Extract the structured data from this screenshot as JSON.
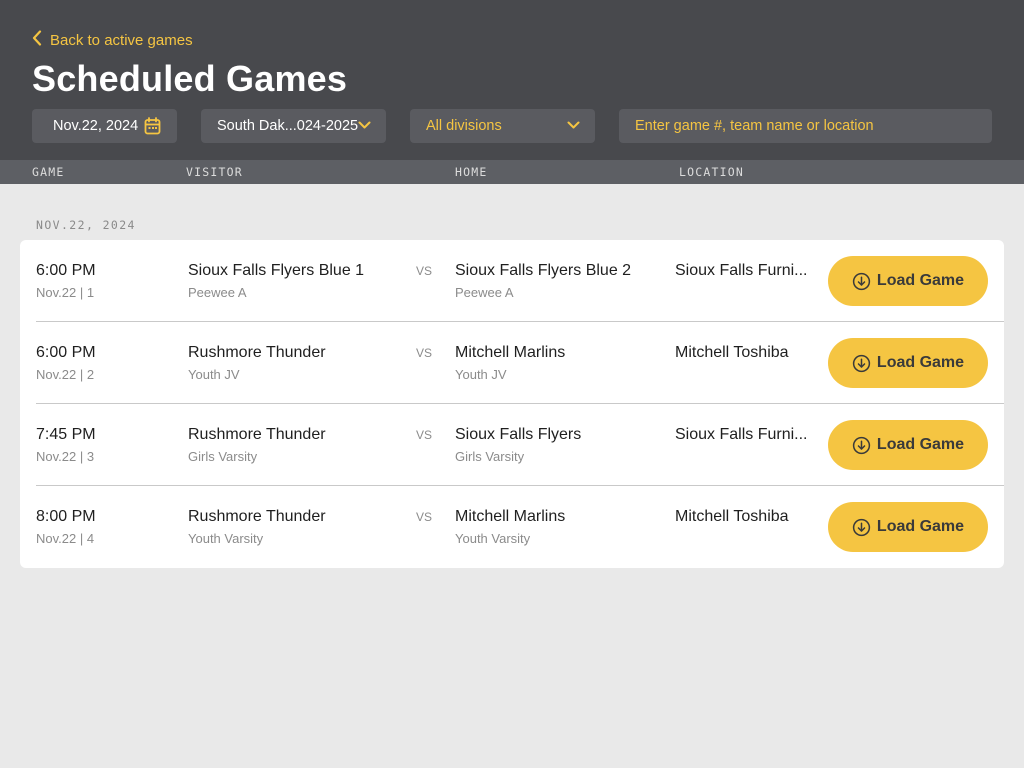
{
  "nav": {
    "back_label": "Back to active games"
  },
  "page": {
    "title": "Scheduled Games"
  },
  "filters": {
    "date": "Nov.22, 2024",
    "league": "South Dak...024-2025",
    "division": "All divisions",
    "search_placeholder": "Enter game #, team name or location"
  },
  "columns": {
    "game": "GAME",
    "visitor": "VISITOR",
    "home": "HOME",
    "location": "LOCATION"
  },
  "date_heading": "NOV.22, 2024",
  "vs_label": "VS",
  "load_label": "Load Game",
  "games": [
    {
      "time": "6:00 PM",
      "meta": "Nov.22 | 1",
      "visitor": "Sioux Falls Flyers Blue 1",
      "visitor_div": "Peewee A",
      "home": "Sioux Falls Flyers Blue 2",
      "home_div": "Peewee A",
      "location": "Sioux Falls Furni..."
    },
    {
      "time": "6:00 PM",
      "meta": "Nov.22 | 2",
      "visitor": "Rushmore Thunder",
      "visitor_div": "Youth JV",
      "home": "Mitchell Marlins",
      "home_div": "Youth JV",
      "location": "Mitchell Toshiba"
    },
    {
      "time": "7:45 PM",
      "meta": "Nov.22 | 3",
      "visitor": "Rushmore Thunder",
      "visitor_div": "Girls Varsity",
      "home": "Sioux Falls Flyers",
      "home_div": "Girls Varsity",
      "location": "Sioux Falls Furni..."
    },
    {
      "time": "8:00 PM",
      "meta": "Nov.22 | 4",
      "visitor": "Rushmore Thunder",
      "visitor_div": "Youth Varsity",
      "home": "Mitchell Marlins",
      "home_div": "Youth Varsity",
      "location": "Mitchell Toshiba"
    }
  ],
  "icons": {
    "back": "chevron-left-icon",
    "calendar": "calendar-icon",
    "dropdown": "chevron-down-icon",
    "load": "download-circle-icon"
  },
  "colors": {
    "header_bg": "#48494d",
    "accent": "#f5c542",
    "page_bg": "#e9e9e9",
    "card_bg": "#ffffff"
  }
}
